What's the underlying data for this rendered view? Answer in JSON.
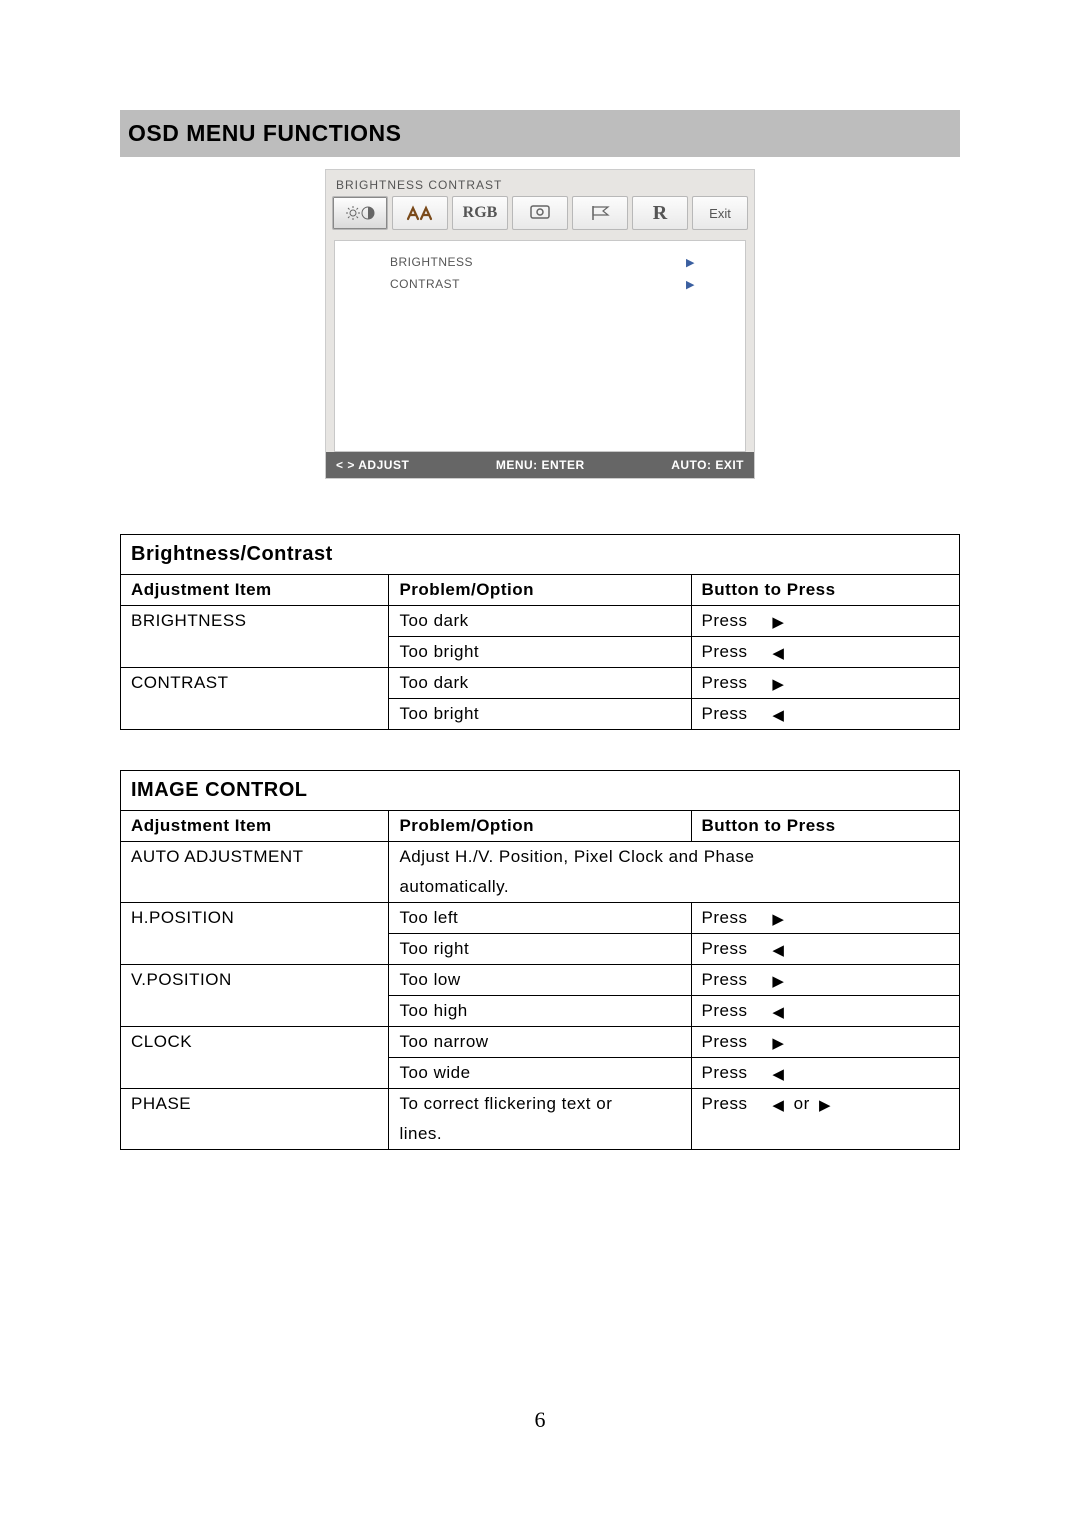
{
  "page_title": "OSD MENU FUNCTIONS",
  "page_number": "6",
  "osd": {
    "top_label": "BRIGHTNESS   CONTRAST",
    "tabs": {
      "rgb": "RGB",
      "reset": "R",
      "exit": "Exit"
    },
    "rows": [
      {
        "label": "BRIGHTNESS"
      },
      {
        "label": "CONTRAST"
      }
    ],
    "footer": {
      "adjust": "ADJUST",
      "menu": "MENU: ENTER",
      "auto": "AUTO: EXIT"
    }
  },
  "table1": {
    "title": "Brightness/Contrast",
    "headers": [
      "Adjustment Item",
      "Problem/Option",
      "Button to Press"
    ],
    "rows": [
      {
        "item": "BRIGHTNESS",
        "option": "Too dark",
        "press": "Press",
        "dir": "right"
      },
      {
        "item": "",
        "option": "Too bright",
        "press": "Press",
        "dir": "left"
      },
      {
        "item": "CONTRAST",
        "option": "Too dark",
        "press": "Press",
        "dir": "right"
      },
      {
        "item": "",
        "option": "Too bright",
        "press": "Press",
        "dir": "left"
      }
    ]
  },
  "table2": {
    "title": "IMAGE CONTROL",
    "headers": [
      "Adjustment Item",
      "Problem/Option",
      "Button to Press"
    ],
    "auto_item": "AUTO ADJUSTMENT",
    "auto_desc1": "Adjust H./V. Position, Pixel Clock and Phase",
    "auto_desc2": "automatically.",
    "rows": [
      {
        "item": "H.POSITION",
        "option": "Too left",
        "press": "Press",
        "dir": "right"
      },
      {
        "item": "",
        "option": "Too right",
        "press": "Press",
        "dir": "left"
      },
      {
        "item": "V.POSITION",
        "option": "Too low",
        "press": "Press",
        "dir": "right"
      },
      {
        "item": "",
        "option": "Too high",
        "press": "Press",
        "dir": "left"
      },
      {
        "item": "CLOCK",
        "option": "Too narrow",
        "press": "Press",
        "dir": "right"
      },
      {
        "item": "",
        "option": "Too wide",
        "press": "Press",
        "dir": "left"
      }
    ],
    "phase": {
      "item": "PHASE",
      "option1": "To correct flickering text or",
      "option2": "lines.",
      "press": "Press",
      "or": "or"
    }
  }
}
